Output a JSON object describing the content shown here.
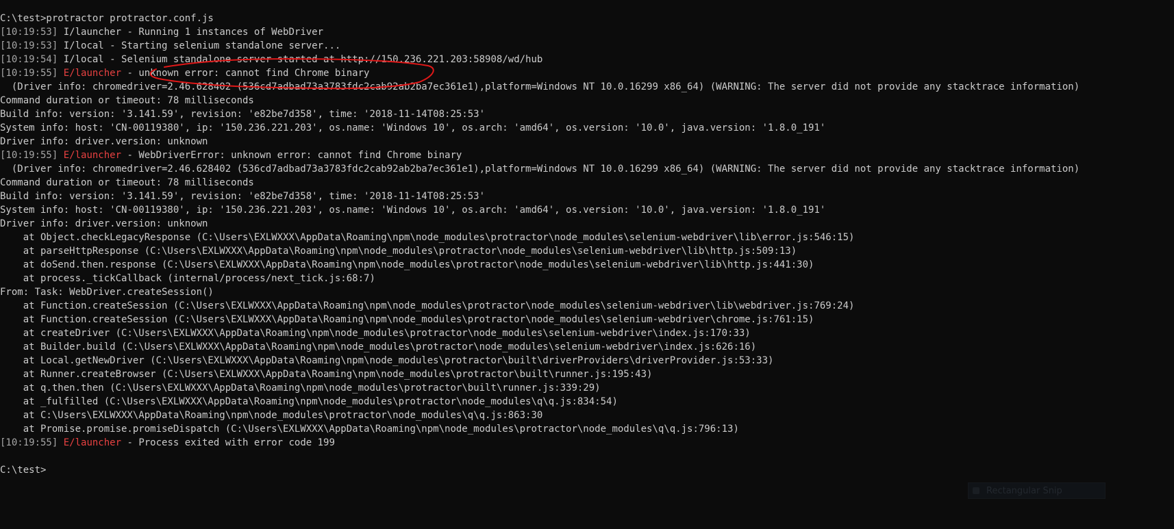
{
  "colors": {
    "background": "#0c0c0c",
    "text": "#cccccc",
    "timestamp": "#a6a6a6",
    "error_tag": "#e84141",
    "annotation_circle": "#e01818"
  },
  "terminal": {
    "lines": [
      {
        "type": "plain",
        "text": "C:\\test>protractor protractor.conf.js"
      },
      {
        "type": "log",
        "ts": "[10:19:53]",
        "tag": "I/launcher",
        "tag_kind": "info",
        "msg": " - Running 1 instances of WebDriver"
      },
      {
        "type": "log",
        "ts": "[10:19:53]",
        "tag": "I/local",
        "tag_kind": "info",
        "msg": " - Starting selenium standalone server..."
      },
      {
        "type": "log",
        "ts": "[10:19:54]",
        "tag": "I/local",
        "tag_kind": "info",
        "msg": " - Selenium standalone server started at http://150.236.221.203:58908/wd/hub"
      },
      {
        "type": "log",
        "ts": "[10:19:55]",
        "tag": "E/launcher",
        "tag_kind": "error",
        "msg": " - unknown error: cannot find Chrome binary"
      },
      {
        "type": "plain",
        "text": "  (Driver info: chromedriver=2.46.628402 (536cd7adbad73a3783fdc2cab92ab2ba7ec361e1),platform=Windows NT 10.0.16299 x86_64) (WARNING: The server did not provide any stacktrace information)"
      },
      {
        "type": "plain",
        "text": "Command duration or timeout: 78 milliseconds"
      },
      {
        "type": "plain",
        "text": "Build info: version: '3.141.59', revision: 'e82be7d358', time: '2018-11-14T08:25:53'"
      },
      {
        "type": "plain",
        "text": "System info: host: 'CN-00119380', ip: '150.236.221.203', os.name: 'Windows 10', os.arch: 'amd64', os.version: '10.0', java.version: '1.8.0_191'"
      },
      {
        "type": "plain",
        "text": "Driver info: driver.version: unknown"
      },
      {
        "type": "log",
        "ts": "[10:19:55]",
        "tag": "E/launcher",
        "tag_kind": "error",
        "msg": " - WebDriverError: unknown error: cannot find Chrome binary"
      },
      {
        "type": "plain",
        "text": "  (Driver info: chromedriver=2.46.628402 (536cd7adbad73a3783fdc2cab92ab2ba7ec361e1),platform=Windows NT 10.0.16299 x86_64) (WARNING: The server did not provide any stacktrace information)"
      },
      {
        "type": "plain",
        "text": "Command duration or timeout: 78 milliseconds"
      },
      {
        "type": "plain",
        "text": "Build info: version: '3.141.59', revision: 'e82be7d358', time: '2018-11-14T08:25:53'"
      },
      {
        "type": "plain",
        "text": "System info: host: 'CN-00119380', ip: '150.236.221.203', os.name: 'Windows 10', os.arch: 'amd64', os.version: '10.0', java.version: '1.8.0_191'"
      },
      {
        "type": "plain",
        "text": "Driver info: driver.version: unknown"
      },
      {
        "type": "plain",
        "text": "    at Object.checkLegacyResponse (C:\\Users\\EXLWXXX\\AppData\\Roaming\\npm\\node_modules\\protractor\\node_modules\\selenium-webdriver\\lib\\error.js:546:15)"
      },
      {
        "type": "plain",
        "text": "    at parseHttpResponse (C:\\Users\\EXLWXXX\\AppData\\Roaming\\npm\\node_modules\\protractor\\node_modules\\selenium-webdriver\\lib\\http.js:509:13)"
      },
      {
        "type": "plain",
        "text": "    at doSend.then.response (C:\\Users\\EXLWXXX\\AppData\\Roaming\\npm\\node_modules\\protractor\\node_modules\\selenium-webdriver\\lib\\http.js:441:30)"
      },
      {
        "type": "plain",
        "text": "    at process._tickCallback (internal/process/next_tick.js:68:7)"
      },
      {
        "type": "plain",
        "text": "From: Task: WebDriver.createSession()"
      },
      {
        "type": "plain",
        "text": "    at Function.createSession (C:\\Users\\EXLWXXX\\AppData\\Roaming\\npm\\node_modules\\protractor\\node_modules\\selenium-webdriver\\lib\\webdriver.js:769:24)"
      },
      {
        "type": "plain",
        "text": "    at Function.createSession (C:\\Users\\EXLWXXX\\AppData\\Roaming\\npm\\node_modules\\protractor\\node_modules\\selenium-webdriver\\chrome.js:761:15)"
      },
      {
        "type": "plain",
        "text": "    at createDriver (C:\\Users\\EXLWXXX\\AppData\\Roaming\\npm\\node_modules\\protractor\\node_modules\\selenium-webdriver\\index.js:170:33)"
      },
      {
        "type": "plain",
        "text": "    at Builder.build (C:\\Users\\EXLWXXX\\AppData\\Roaming\\npm\\node_modules\\protractor\\node_modules\\selenium-webdriver\\index.js:626:16)"
      },
      {
        "type": "plain",
        "text": "    at Local.getNewDriver (C:\\Users\\EXLWXXX\\AppData\\Roaming\\npm\\node_modules\\protractor\\built\\driverProviders\\driverProvider.js:53:33)"
      },
      {
        "type": "plain",
        "text": "    at Runner.createBrowser (C:\\Users\\EXLWXXX\\AppData\\Roaming\\npm\\node_modules\\protractor\\built\\runner.js:195:43)"
      },
      {
        "type": "plain",
        "text": "    at q.then.then (C:\\Users\\EXLWXXX\\AppData\\Roaming\\npm\\node_modules\\protractor\\built\\runner.js:339:29)"
      },
      {
        "type": "plain",
        "text": "    at _fulfilled (C:\\Users\\EXLWXXX\\AppData\\Roaming\\npm\\node_modules\\protractor\\node_modules\\q\\q.js:834:54)"
      },
      {
        "type": "plain",
        "text": "    at C:\\Users\\EXLWXXX\\AppData\\Roaming\\npm\\node_modules\\protractor\\node_modules\\q\\q.js:863:30"
      },
      {
        "type": "plain",
        "text": "    at Promise.promise.promiseDispatch (C:\\Users\\EXLWXXX\\AppData\\Roaming\\npm\\node_modules\\protractor\\node_modules\\q\\q.js:796:13)"
      },
      {
        "type": "log",
        "ts": "[10:19:55]",
        "tag": "E/launcher",
        "tag_kind": "error",
        "msg": " - Process exited with error code 199"
      },
      {
        "type": "plain",
        "text": ""
      },
      {
        "type": "plain",
        "text": "C:\\test>"
      }
    ]
  },
  "snip_toast": {
    "label": "Rectangular Snip",
    "icon": "scissors-icon"
  }
}
